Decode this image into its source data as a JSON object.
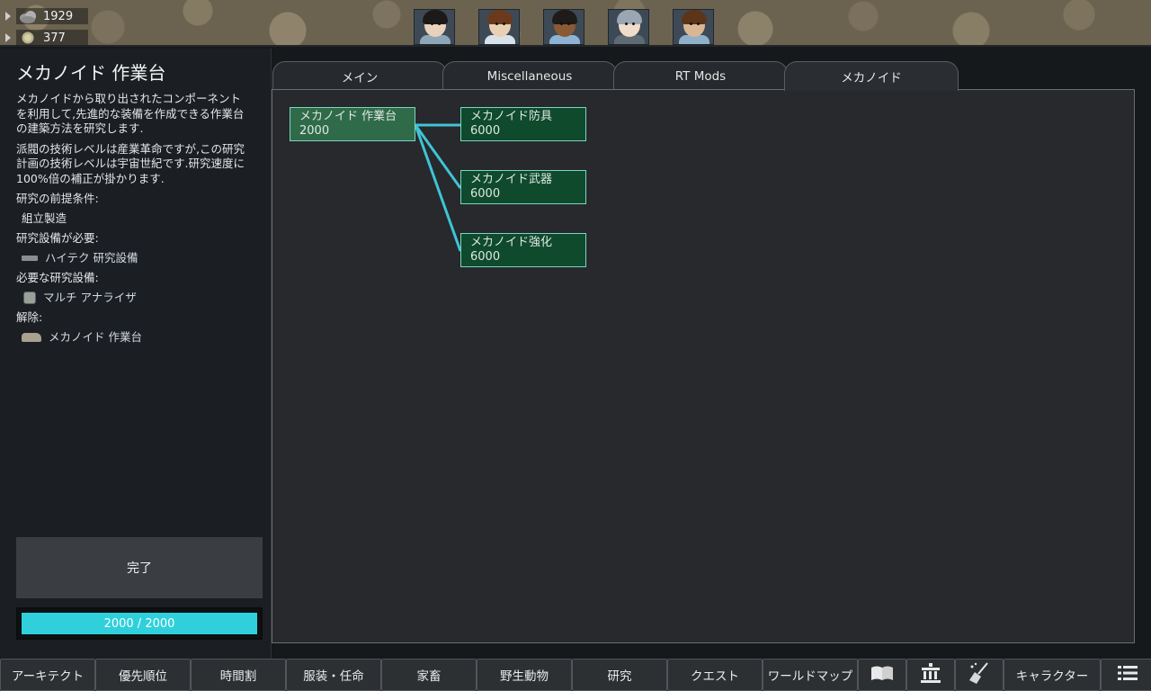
{
  "resources": [
    {
      "icon": "cloud-icon",
      "value": "1929"
    },
    {
      "icon": "silver-coin-icon",
      "value": "377"
    }
  ],
  "colonists": [
    {
      "hair": "#1c1a18",
      "skin": "#e8d2bb",
      "body": "#8da7b8"
    },
    {
      "hair": "#6b3a1c",
      "skin": "#e9d0b3",
      "body": "#d9e2ea"
    },
    {
      "hair": "#1e1b18",
      "skin": "#8a5a35",
      "body": "#8fb3d3"
    },
    {
      "hair": "#9aa6b2",
      "skin": "#f0dcc8",
      "body": "#5e6a74"
    },
    {
      "hair": "#5c3418",
      "skin": "#d9b795",
      "body": "#8fb0c9"
    }
  ],
  "project": {
    "title": "メカノイド 作業台",
    "description": "メカノイドから取り出されたコンポーネントを利用して,先進的な装備を作成できる作業台の建築方法を研究します.",
    "tech_note": "派閥の技術レベルは産業革命ですが,この研究計画の技術レベルは宇宙世紀です.研究速度に100%倍の補正が掛かります.",
    "prereq_label": "研究の前提条件:",
    "prereq_item": "組立製造",
    "bench_label": "研究設備が必要:",
    "bench_item": "ハイテク 研究設備",
    "facility_label": "必要な研究設備:",
    "facility_item": "マルチ アナライザ",
    "unlock_label": "解除:",
    "unlock_item": "メカノイド 作業台",
    "status": "完了",
    "progress_text": "2000 / 2000",
    "progress_fraction": 1.0
  },
  "tabs": [
    {
      "label": "メイン"
    },
    {
      "label": "Miscellaneous"
    },
    {
      "label": "RT Mods"
    },
    {
      "label": "メカノイド"
    }
  ],
  "active_tab": 3,
  "tree": {
    "nodes": [
      {
        "name": "メカノイド 作業台",
        "cost": "2000",
        "state": "done"
      },
      {
        "name": "メカノイド防具",
        "cost": "6000",
        "state": "todo"
      },
      {
        "name": "メカノイド武器",
        "cost": "6000",
        "state": "todo"
      },
      {
        "name": "メカノイド強化",
        "cost": "6000",
        "state": "todo"
      }
    ],
    "link_color": "#3fc4d6"
  },
  "bottom_bar": [
    {
      "label": "アーキテクト"
    },
    {
      "label": "優先順位"
    },
    {
      "label": "時間割"
    },
    {
      "label": "服装・任命"
    },
    {
      "label": "家畜"
    },
    {
      "label": "野生動物"
    },
    {
      "label": "研究"
    },
    {
      "label": "クエスト"
    },
    {
      "label": "ワールドマップ"
    },
    {
      "icon": "book-icon"
    },
    {
      "icon": "faction-building-icon"
    },
    {
      "icon": "broom-icon"
    },
    {
      "label": "キャラクター"
    },
    {
      "icon": "menu-icon"
    }
  ]
}
